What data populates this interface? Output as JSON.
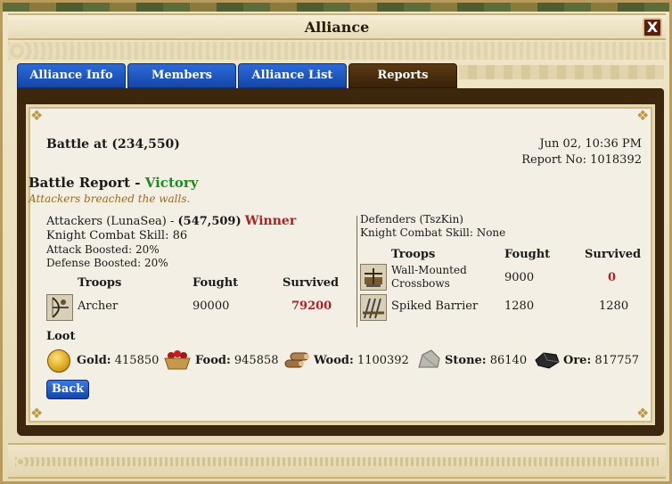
{
  "window": {
    "title": "Alliance",
    "close_label": "X"
  },
  "tabs": [
    {
      "label": "Alliance Info",
      "active": false
    },
    {
      "label": "Members",
      "active": false
    },
    {
      "label": "Alliance List",
      "active": false
    },
    {
      "label": "Reports",
      "active": true
    }
  ],
  "report": {
    "battle_at": "Battle at (234,550)",
    "datetime": "Jun 02, 10:36 PM",
    "report_no": "Report No: 1018392",
    "battle_report_label": "Battle Report - ",
    "result": "Victory",
    "subtitle": "Attackers breached the walls.",
    "attackers": {
      "header_prefix": "Attackers (LunaSea) - ",
      "might": "(547,509)",
      "winner_label": "Winner",
      "knight_skill": "Knight Combat Skill: 86",
      "attack_boost": "Attack Boosted: 20%",
      "defense_boost": "Defense Boosted: 20%",
      "col_troops": "Troops",
      "col_fought": "Fought",
      "col_survived": "Survived",
      "troops": [
        {
          "icon": "archer-icon",
          "name": "Archer",
          "fought": "90000",
          "survived": "79200"
        }
      ]
    },
    "defenders": {
      "header": "Defenders (TszKin)",
      "knight_skill": "Knight Combat Skill: None",
      "col_troops": "Troops",
      "col_fought": "Fought",
      "col_survived": "Survived",
      "troops": [
        {
          "icon": "crossbow-icon",
          "name_line1": "Wall-Mounted",
          "name_line2": "Crossbows",
          "fought": "9000",
          "survived": "0"
        },
        {
          "icon": "spiked-barrier-icon",
          "name": "Spiked Barrier",
          "fought": "1280",
          "survived": "1280"
        }
      ]
    },
    "loot": {
      "label": "Loot",
      "gold_label": "Gold:",
      "gold": "415850",
      "food_label": "Food:",
      "food": "945858",
      "wood_label": "Wood:",
      "wood": "1100392",
      "stone_label": "Stone:",
      "stone": "86140",
      "ore_label": "Ore:",
      "ore": "817757"
    },
    "back_label": "Back"
  },
  "colors": {
    "tab_blue": "#1f5bc9",
    "tab_active": "#4a2e10",
    "victory_green": "#1f8a1f",
    "winner_red": "#a22222",
    "subtitle_orange": "#9a6a1e"
  }
}
